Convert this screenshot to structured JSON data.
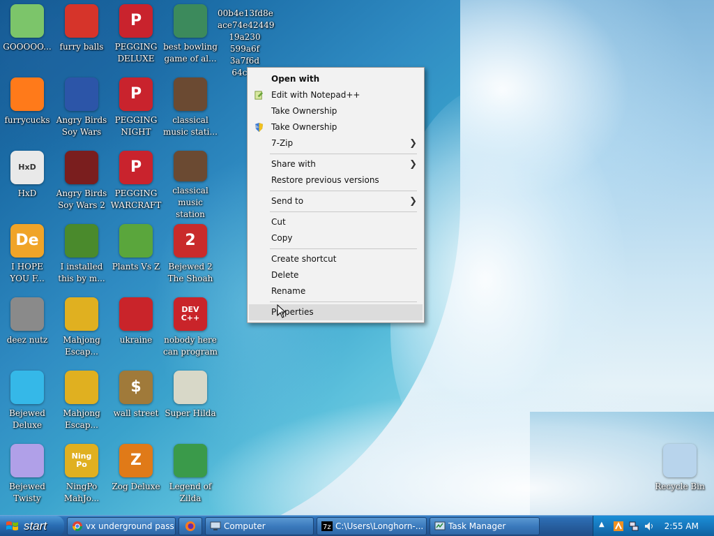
{
  "desktop": {
    "icons": [
      {
        "label": "GOOOOO...",
        "color": "#7cc56a",
        "glyph": ""
      },
      {
        "label": "furry balls",
        "color": "#d6342a",
        "glyph": ""
      },
      {
        "label": "PEGGING\nDELUXE",
        "color": "#c9232d",
        "glyph": "P"
      },
      {
        "label": "best bowling\ngame of al...",
        "color": "#3c8a5c",
        "glyph": ""
      },
      {
        "label": "00b4e13fd8e\nace74e42449\n19a230\n599a6f\n3a7f6d\n64c65",
        "color": "#ffffff",
        "glyph": ""
      },
      {
        "label": "furrycucks",
        "color": "#ff7a1a",
        "glyph": ""
      },
      {
        "label": "Angry Birds\nSoy Wars",
        "color": "#2c55a8",
        "glyph": ""
      },
      {
        "label": "PEGGING\nNIGHT",
        "color": "#c9232d",
        "glyph": "P"
      },
      {
        "label": "classical\nmusic stati...",
        "color": "#6b4a32",
        "glyph": ""
      },
      {
        "label": "HxD",
        "color": "#e9e9e9",
        "glyph": "HxD"
      },
      {
        "label": "Angry Birds\nSoy Wars 2",
        "color": "#7a1e1e",
        "glyph": ""
      },
      {
        "label": "PEGGING\nWARCRAFT",
        "color": "#c9232d",
        "glyph": "P"
      },
      {
        "label": "classical\nmusic station",
        "color": "#6b4a32",
        "glyph": ""
      },
      {
        "label": "I HOPE\nYOU F...",
        "color": "#f0a428",
        "glyph": "De"
      },
      {
        "label": "I installed\nthis by m...",
        "color": "#4a8a2c",
        "glyph": ""
      },
      {
        "label": "Plants Vs Z",
        "color": "#5aa63c",
        "glyph": ""
      },
      {
        "label": "Bejewed 2\nThe Shoah",
        "color": "#c92b2b",
        "glyph": "2"
      },
      {
        "label": "deez nutz",
        "color": "#8a8a8a",
        "glyph": ""
      },
      {
        "label": "Mahjong\nEscap...",
        "color": "#e0b020",
        "glyph": ""
      },
      {
        "label": "ukraine",
        "color": "#c9242a",
        "glyph": ""
      },
      {
        "label": "nobody here\ncan program",
        "color": "#c9242a",
        "glyph": "DEV\nC++"
      },
      {
        "label": "Bejewed\nDeluxe",
        "color": "#35b8e8",
        "glyph": ""
      },
      {
        "label": "Mahjong\nEscap...",
        "color": "#e0b020",
        "glyph": ""
      },
      {
        "label": "wall street",
        "color": "#a07a3a",
        "glyph": "$"
      },
      {
        "label": "Super Hilda",
        "color": "#d8d8c8",
        "glyph": ""
      },
      {
        "label": "Bejewed\nTwisty",
        "color": "#b0a0e8",
        "glyph": ""
      },
      {
        "label": "NingPo\nMahJo...",
        "color": "#e0b020",
        "glyph": "Ning\nPo"
      },
      {
        "label": "Zog Deluxe",
        "color": "#e07a18",
        "glyph": "Z"
      },
      {
        "label": "Legend of\nZilda",
        "color": "#3a9a4a",
        "glyph": ""
      },
      {
        "label": "Recycle Bin",
        "color": "#b8d4ec",
        "glyph": ""
      }
    ]
  },
  "context_menu": {
    "items": [
      {
        "label": "Open with",
        "bold": true
      },
      {
        "label": "Edit with Notepad++",
        "icon": "notepad-plus-icon"
      },
      {
        "label": "Take Ownership"
      },
      {
        "label": "Take Ownership",
        "icon": "shield-icon"
      },
      {
        "label": "7-Zip",
        "submenu": true
      },
      {
        "label": "Share with",
        "submenu": true
      },
      {
        "label": "Restore previous versions"
      },
      {
        "label": "Send to",
        "submenu": true
      },
      {
        "label": "Cut"
      },
      {
        "label": "Copy"
      },
      {
        "label": "Create shortcut"
      },
      {
        "label": "Delete"
      },
      {
        "label": "Rename"
      },
      {
        "label": "Properties",
        "highlighted": true
      }
    ]
  },
  "taskbar": {
    "start_label": "start",
    "buttons": [
      {
        "label": "vx underground pass...",
        "icon": "chrome-icon"
      },
      {
        "label": "",
        "icon": "firefox-icon"
      },
      {
        "label": "Computer",
        "icon": "computer-icon"
      },
      {
        "label": "C:\\Users\\Longhorn-...",
        "icon": "7zip-icon"
      },
      {
        "label": "Task Manager",
        "icon": "task-manager-icon"
      }
    ],
    "clock": "2:55 AM"
  }
}
